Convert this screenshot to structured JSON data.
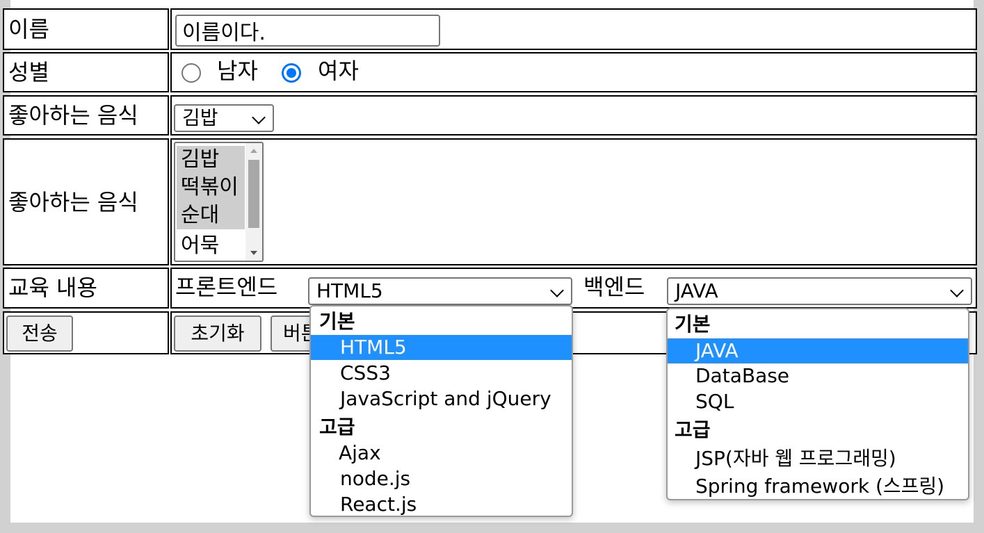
{
  "form": {
    "name_label": "이름",
    "name_value": "이름이다.",
    "gender_label": "성별",
    "gender_options": [
      "남자",
      "여자"
    ],
    "gender_selected": "여자",
    "food_label": "좋아하는 음식",
    "food_select_value": "김밥",
    "food_list_label": "좋아하는 음식",
    "food_list_options": [
      "김밥",
      "떡볶이",
      "순대",
      "어묵"
    ],
    "food_list_selected": [
      "김밥",
      "떡볶이",
      "순대"
    ],
    "edu_label": "교육 내용",
    "frontend_label": "프론트엔드",
    "frontend_value": "HTML5",
    "backend_label": "백엔드",
    "backend_value": "JAVA",
    "submit_label": "전송",
    "reset_label": "초기화",
    "button_label": "버튼"
  },
  "frontend_dropdown": {
    "groups": [
      {
        "label": "기본",
        "options": [
          "HTML5",
          "CSS3",
          "JavaScript and jQuery"
        ]
      },
      {
        "label": "고급",
        "options": [
          "Ajax",
          "node.js",
          "React.js"
        ]
      }
    ],
    "selected": "HTML5"
  },
  "backend_dropdown": {
    "groups": [
      {
        "label": "기본",
        "options": [
          "JAVA",
          "DataBase",
          "SQL"
        ]
      },
      {
        "label": "고급",
        "options": [
          "JSP(자바 웹 프로그래밍)",
          "Spring framework (스프링)"
        ]
      }
    ],
    "selected": "JAVA"
  },
  "colors": {
    "selection_highlight": "#1e90ff",
    "radio_accent": "#0075ff",
    "listbox_selected": "#cecece"
  }
}
